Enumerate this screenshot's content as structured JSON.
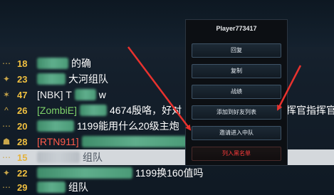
{
  "chat": {
    "rows": [
      {
        "icon": "⋯",
        "level": "18",
        "tag": "",
        "text": "的确"
      },
      {
        "icon": "✦",
        "level": "23",
        "tag": "",
        "text": "大河组队"
      },
      {
        "icon": "✶",
        "level": "47",
        "tag": "[NBK] T",
        "text": "w"
      },
      {
        "icon": "^",
        "level": "26",
        "tag": "[ZombiE]",
        "text": "4674殷咯，好对",
        "tail": "挥官指挥官"
      },
      {
        "icon": "⋯",
        "level": "20",
        "tag": "",
        "text": "1199能用什么20级主炮"
      },
      {
        "icon": "☗",
        "level": "28",
        "tag": "[RTN911]",
        "text": ""
      },
      {
        "icon": "⋯",
        "level": "15",
        "tag": "",
        "text": "组队"
      },
      {
        "icon": "✦",
        "level": "22",
        "tag": "",
        "text": "1199换160值吗"
      },
      {
        "icon": "⋯",
        "level": "29",
        "tag": "",
        "text": "组队"
      }
    ]
  },
  "menu": {
    "player_name": "Player773417",
    "buttons": [
      {
        "label": "回复",
        "color": "#e8eef4"
      },
      {
        "label": "复制",
        "color": "#e8eef4"
      },
      {
        "label": "战绩",
        "color": "#e8eef4"
      },
      {
        "label": "添加到好友列表",
        "color": "#e8eef4"
      },
      {
        "label": "邀请进入中队",
        "color": "#e8eef4"
      },
      {
        "label": "列入黑名单",
        "color": "#ff3b3b"
      }
    ]
  },
  "colors": {
    "accent_red": "#e8322e",
    "level_gold": "#f0c040",
    "selected_row": "#d4d8dc"
  }
}
